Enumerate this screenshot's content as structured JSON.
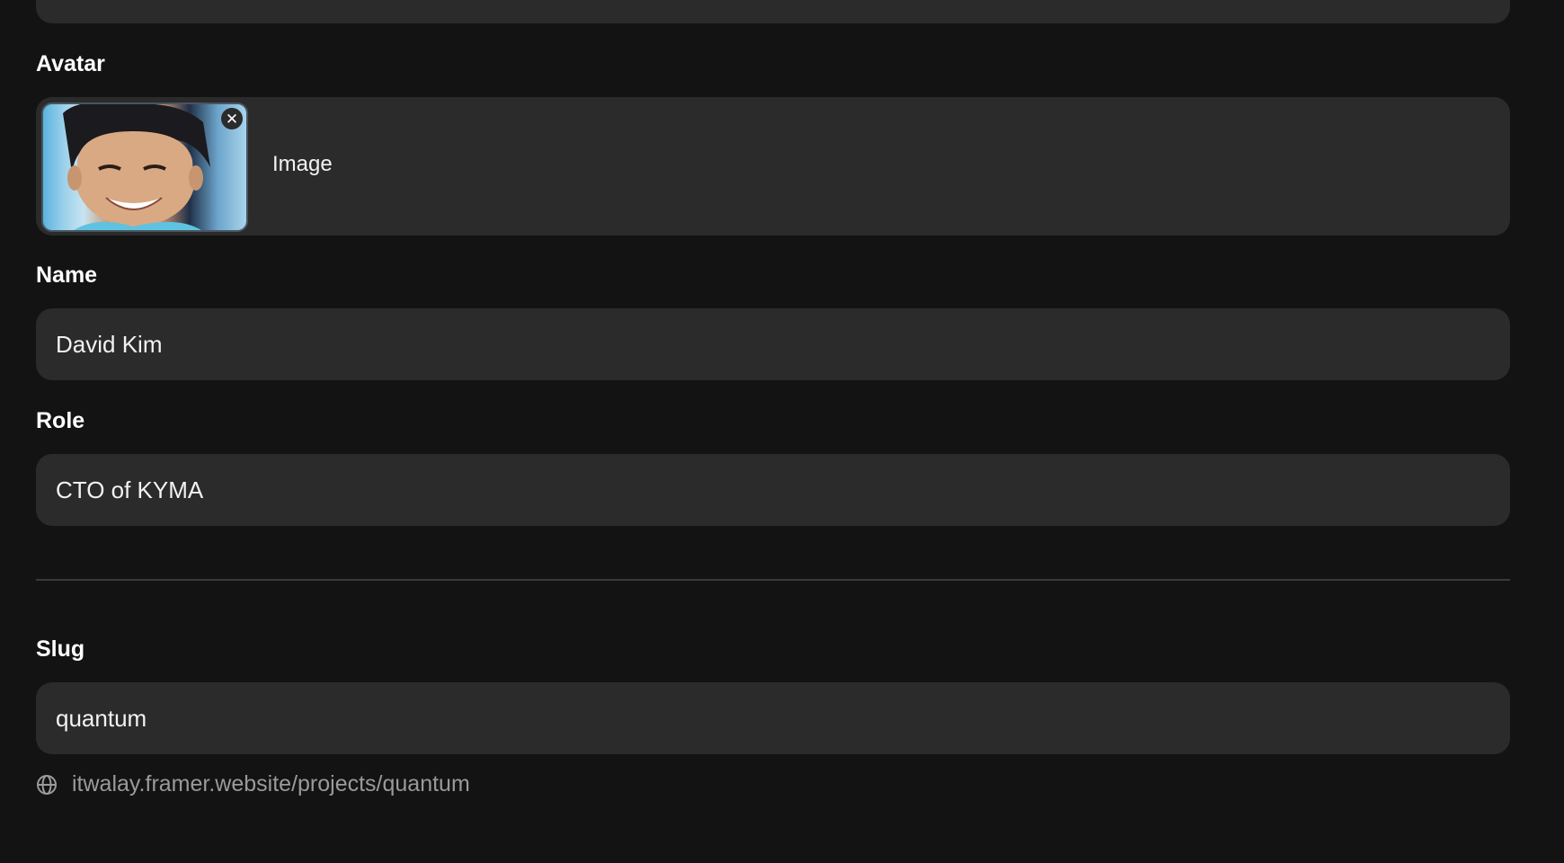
{
  "avatar": {
    "label": "Avatar",
    "caption": "Image",
    "remove_glyph": "✕",
    "image_icon": "person-photo",
    "remove_icon": "close-icon"
  },
  "name": {
    "label": "Name",
    "value": "David Kim"
  },
  "role": {
    "label": "Role",
    "value": "CTO of KYMA"
  },
  "slug": {
    "label": "Slug",
    "value": "quantum",
    "url": "itwalay.framer.website/projects/quantum",
    "url_icon": "globe-icon"
  },
  "colors": {
    "background": "#131313",
    "field": "#2b2b2b",
    "text": "#ffffff",
    "muted": "#9a9a9a",
    "divider": "#3a3a3a"
  }
}
